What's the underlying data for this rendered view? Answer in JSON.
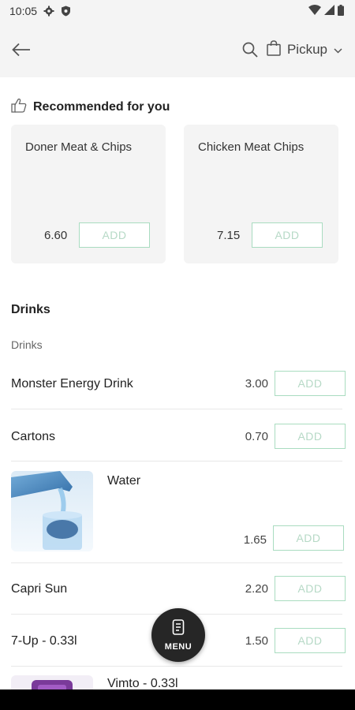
{
  "status_bar": {
    "time": "10:05"
  },
  "header": {
    "pickup_label": "Pickup"
  },
  "recommended": {
    "title": "Recommended for you",
    "items": [
      {
        "name": "Doner Meat & Chips",
        "price": "6.60",
        "add_label": "ADD"
      },
      {
        "name": "Chicken Meat Chips",
        "price": "7.15",
        "add_label": "ADD"
      }
    ]
  },
  "section": {
    "title": "Drinks",
    "subtitle": "Drinks"
  },
  "items": [
    {
      "name": "Monster Energy Drink",
      "price": "3.00",
      "add_label": "ADD"
    },
    {
      "name": "Cartons",
      "price": "0.70",
      "add_label": "ADD"
    },
    {
      "name": "Water",
      "price": "1.65",
      "add_label": "ADD"
    },
    {
      "name": "Capri Sun",
      "price": "2.20",
      "add_label": "ADD"
    },
    {
      "name": "7-Up - 0.33l",
      "price": "1.50",
      "add_label": "ADD"
    },
    {
      "name": "Vimto - 0.33l"
    }
  ],
  "menu_button": {
    "label": "MENU"
  },
  "colors": {
    "accent_border": "#a9dcc0",
    "add_text": "#b6d9c6",
    "fab": "#262626"
  }
}
